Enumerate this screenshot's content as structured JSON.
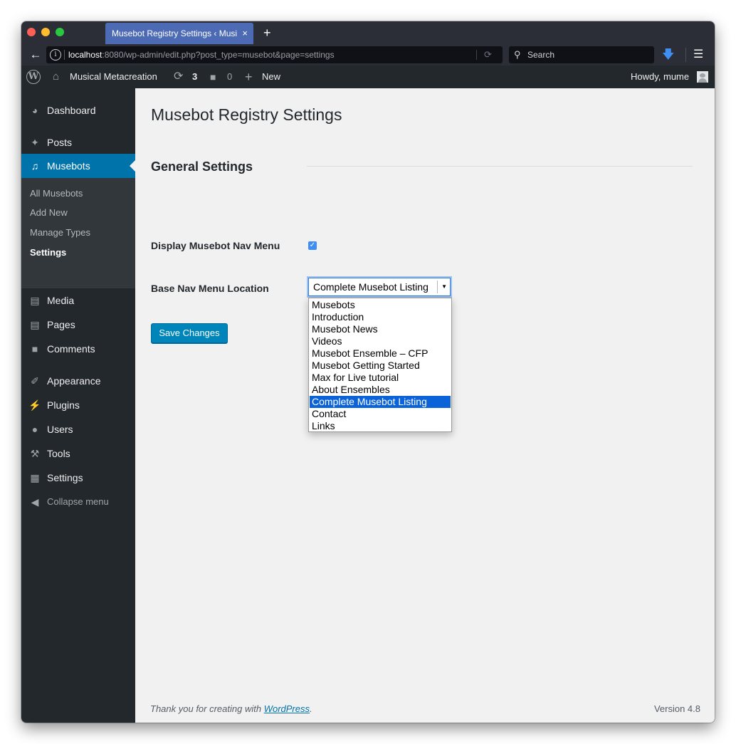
{
  "browser": {
    "tab_title": "Musebot Registry Settings ‹ Musi",
    "tab_close": "×",
    "new_tab": "+",
    "url_host": "localhost",
    "url_rest": ":8080/wp-admin/edit.php?post_type=musebot&page=settings",
    "search_placeholder": "Search"
  },
  "admin_bar": {
    "site_name": "Musical Metacreation",
    "updates_count": "3",
    "comments_count": "0",
    "new_label": "New",
    "greeting": "Howdy, mume"
  },
  "sidebar": {
    "dashboard": "Dashboard",
    "posts": "Posts",
    "musebots": "Musebots",
    "submenu": [
      "All Musebots",
      "Add New",
      "Manage Types",
      "Settings"
    ],
    "media": "Media",
    "pages": "Pages",
    "comments": "Comments",
    "appearance": "Appearance",
    "plugins": "Plugins",
    "users": "Users",
    "tools": "Tools",
    "settings": "Settings",
    "collapse": "Collapse menu"
  },
  "main": {
    "page_title": "Musebot Registry Settings",
    "section_title": "General Settings",
    "nav_menu_label": "Display Musebot Nav Menu",
    "nav_menu_checked": true,
    "base_location_label": "Base Nav Menu Location",
    "base_location_value": "Complete Musebot Listing",
    "options": [
      "Musebots",
      "Introduction",
      "Musebot News",
      "Videos",
      "Musebot Ensemble – CFP",
      "Musebot Getting Started",
      "Max for Live tutorial",
      "About Ensembles",
      "Complete Musebot Listing",
      "Contact",
      "Links"
    ],
    "selected_option_index": 8,
    "save_button": "Save Changes"
  },
  "footer": {
    "thanks_prefix": "Thank you for creating with ",
    "thanks_link": "WordPress",
    "thanks_suffix": ".",
    "version": "Version 4.8"
  },
  "colors": {
    "accent": "#0073aa",
    "button": "#0085ba",
    "sidebar_bg": "#23282d",
    "content_bg": "#f1f1f1",
    "option_highlight": "#0a63d9"
  },
  "icons": [
    "wordpress-logo-icon",
    "home-icon",
    "updates-icon",
    "comments-bubble-icon",
    "plus-icon",
    "dashboard-icon",
    "pin-icon",
    "music-note-icon",
    "media-icon",
    "pages-icon",
    "comment-icon",
    "brush-icon",
    "plugin-icon",
    "user-icon",
    "wrench-icon",
    "settings-sliders-icon",
    "collapse-arrow-icon"
  ]
}
